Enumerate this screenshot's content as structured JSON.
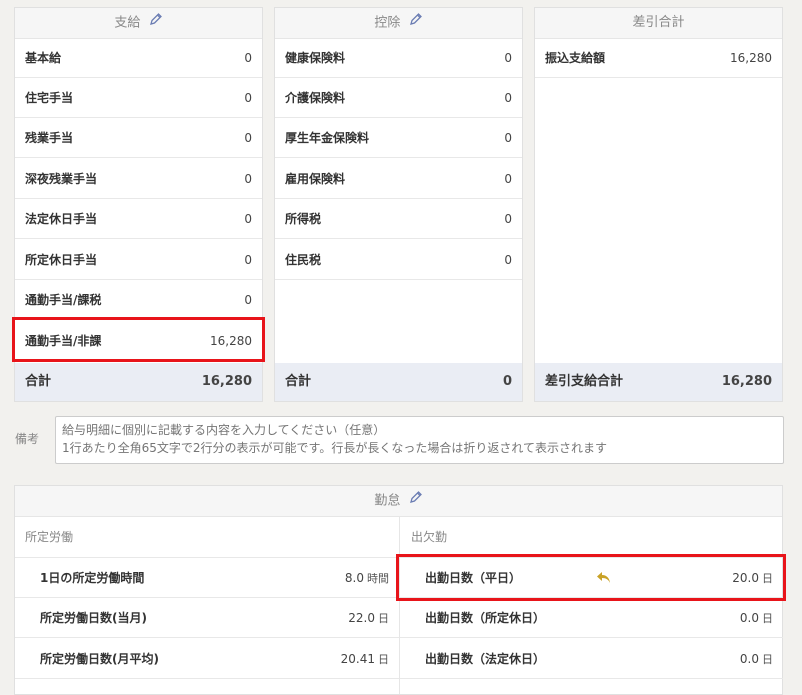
{
  "shikyu": {
    "title": "支給",
    "items": [
      {
        "label": "基本給",
        "value": "0"
      },
      {
        "label": "住宅手当",
        "value": "0"
      },
      {
        "label": "残業手当",
        "value": "0"
      },
      {
        "label": "深夜残業手当",
        "value": "0"
      },
      {
        "label": "法定休日手当",
        "value": "0"
      },
      {
        "label": "所定休日手当",
        "value": "0"
      },
      {
        "label": "通勤手当/課税",
        "value": "0"
      },
      {
        "label": "通勤手当/非課",
        "value": "16,280"
      }
    ],
    "total_label": "合計",
    "total_value": "16,280"
  },
  "kojo": {
    "title": "控除",
    "items": [
      {
        "label": "健康保険料",
        "value": "0"
      },
      {
        "label": "介護保険料",
        "value": "0"
      },
      {
        "label": "厚生年金保険料",
        "value": "0"
      },
      {
        "label": "雇用保険料",
        "value": "0"
      },
      {
        "label": "所得税",
        "value": "0"
      },
      {
        "label": "住民税",
        "value": "0"
      }
    ],
    "total_label": "合計",
    "total_value": "0"
  },
  "sashihiki": {
    "title": "差引合計",
    "items": [
      {
        "label": "振込支給額",
        "value": "16,280"
      }
    ],
    "total_label": "差引支給合計",
    "total_value": "16,280"
  },
  "bikou": {
    "label": "備考",
    "placeholder": "給与明細に個別に記載する内容を入力してください（任意）\n1行あたり全角65文字で2行分の表示が可能です。行長が長くなった場合は折り返されて表示されます"
  },
  "kintai": {
    "title": "勤怠",
    "shotei": {
      "title": "所定労働",
      "items": [
        {
          "label": "1日の所定労働時間",
          "value": "8.0",
          "unit": "時間"
        },
        {
          "label": "所定労働日数(当月)",
          "value": "22.0",
          "unit": "日"
        },
        {
          "label": "所定労働日数(月平均)",
          "value": "20.41",
          "unit": "日"
        }
      ]
    },
    "shukketsu": {
      "title": "出欠勤",
      "items": [
        {
          "label": "出勤日数（平日）",
          "value": "20.0",
          "unit": "日"
        },
        {
          "label": "出勤日数（所定休日）",
          "value": "0.0",
          "unit": "日"
        },
        {
          "label": "出勤日数（法定休日）",
          "value": "0.0",
          "unit": "日"
        }
      ]
    }
  },
  "colors": {
    "highlight": "#e8141a",
    "total_bg": "#eaedf4",
    "pencil": "#6b7db3",
    "arrow": "#c9a227"
  }
}
